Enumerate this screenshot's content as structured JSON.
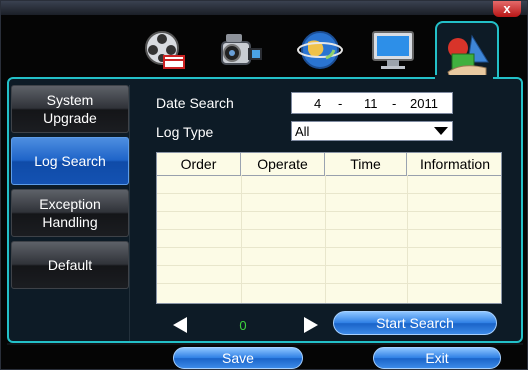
{
  "window": {
    "close_label": "x"
  },
  "top_tabs": [
    {
      "name": "record-tab",
      "icon": "film-reel-icon"
    },
    {
      "name": "camera-tab",
      "icon": "video-camera-icon"
    },
    {
      "name": "network-tab",
      "icon": "globe-icon"
    },
    {
      "name": "display-tab",
      "icon": "monitor-icon"
    },
    {
      "name": "tools-tab",
      "icon": "shapes-tool-icon",
      "active": true
    }
  ],
  "sidebar": {
    "items": [
      {
        "line1": "System",
        "line2": "Upgrade"
      },
      {
        "line1": "Log Search",
        "line2": "",
        "active": true
      },
      {
        "line1": "Exception",
        "line2": "Handling"
      },
      {
        "line1": "Default",
        "line2": ""
      }
    ]
  },
  "form": {
    "date_label": "Date Search",
    "date_day": "4",
    "date_sep1": "-",
    "date_month": "11",
    "date_sep2": "-",
    "date_year": "2011",
    "log_type_label": "Log Type",
    "log_type_value": "All"
  },
  "table": {
    "columns": [
      "Order",
      "Operate",
      "Time",
      "Information"
    ],
    "rows": []
  },
  "pager": {
    "page": "0"
  },
  "buttons": {
    "start_search": "Start Search",
    "save": "Save",
    "exit": "Exit"
  }
}
